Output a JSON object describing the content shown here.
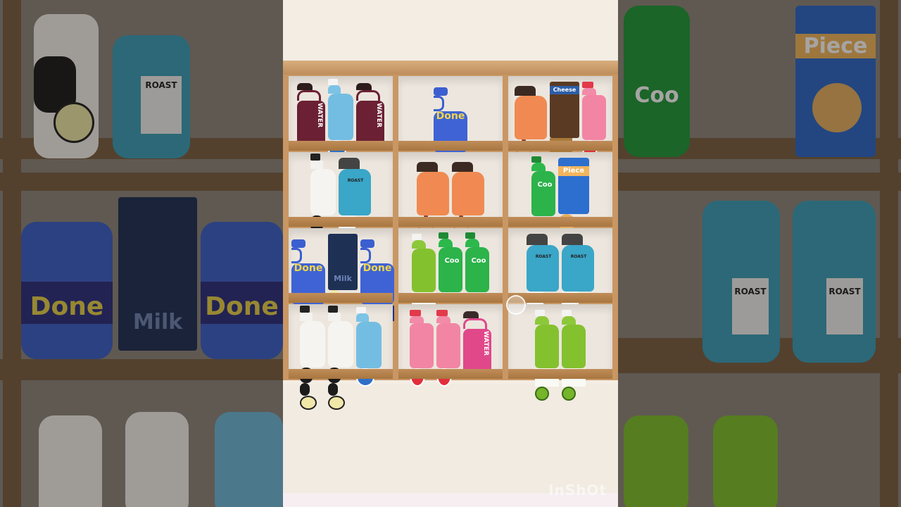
{
  "game": {
    "title": "",
    "watermark": "InShOt"
  },
  "labels": {
    "water": "WATER",
    "done": "Done",
    "cheese": "Cheese",
    "piece": "Piece",
    "cool": "Coo",
    "roast": "ROAST",
    "milk": "Milk"
  },
  "shelf": {
    "rows": [
      [
        [
          "water-jug-maroon",
          "blueberry-bottle",
          "water-jug-maroon"
        ],
        [
          "done-jug-blue"
        ],
        [
          "coffee-bag-orange",
          "cheese-box",
          "strawberry-bottle"
        ]
      ],
      [
        [
          "cow-milk-bottle",
          "roast-bag-blue"
        ],
        [
          "coffee-bag-orange",
          "coffee-bag-orange"
        ],
        [
          "cool-soda-green",
          "piece-cookie-box"
        ]
      ],
      [
        [
          "done-jug-blue",
          "milk-carton-navy",
          "done-jug-blue"
        ],
        [
          "kiwi-bottle",
          "cool-soda-green",
          "cool-soda-green"
        ],
        [
          "roast-bag-blue",
          "roast-bag-blue"
        ]
      ],
      [
        [
          "cow-milk-bottle",
          "cow-milk-bottle",
          "blueberry-bottle"
        ],
        [
          "strawberry-bottle",
          "strawberry-bottle",
          "water-jug-pink"
        ],
        [
          "kiwi-bottle",
          "kiwi-bottle"
        ]
      ]
    ]
  },
  "colors": {
    "wood": "#c99764",
    "wall": "#ece6de",
    "background": "#f3ede4"
  }
}
